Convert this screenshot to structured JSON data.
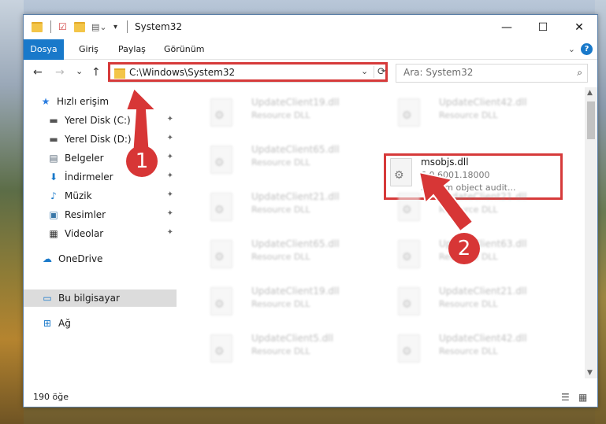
{
  "window": {
    "title": "System32",
    "minimize": "—",
    "maximize": "☐",
    "close": "✕"
  },
  "ribbon": {
    "tabs": [
      "Dosya",
      "Giriş",
      "Paylaş",
      "Görünüm"
    ],
    "help": "?"
  },
  "nav": {
    "back": "←",
    "forward": "→",
    "recent": "⌄",
    "up": "↑"
  },
  "address": {
    "path": "C:\\Windows\\System32",
    "dropdown": "⌄",
    "refresh": "⟳"
  },
  "search": {
    "placeholder": "Ara: System32"
  },
  "sidebar": {
    "items": [
      {
        "label": "Hızlı erişim",
        "icon": "star-icon",
        "glyph": "★",
        "color": "#2b7de0"
      },
      {
        "label": "Yerel Disk (C:)",
        "icon": "drive-icon",
        "glyph": "▬",
        "color": "#444",
        "pinned": true
      },
      {
        "label": "Yerel Disk (D:)",
        "icon": "drive-icon",
        "glyph": "▬",
        "color": "#444",
        "pinned": true
      },
      {
        "label": "Belgeler",
        "icon": "documents-icon",
        "glyph": "▤",
        "color": "#5a6a7a",
        "pinned": true
      },
      {
        "label": "İndirmeler",
        "icon": "download-icon",
        "glyph": "⬇",
        "color": "#1979ca",
        "pinned": true
      },
      {
        "label": "Müzik",
        "icon": "music-icon",
        "glyph": "♪",
        "color": "#1979ca",
        "pinned": true
      },
      {
        "label": "Resimler",
        "icon": "pictures-icon",
        "glyph": "▣",
        "color": "#3a78a8",
        "pinned": true
      },
      {
        "label": "Videolar",
        "icon": "video-icon",
        "glyph": "▦",
        "color": "#333",
        "pinned": true
      },
      {
        "label": "OneDrive",
        "icon": "cloud-icon",
        "glyph": "☁",
        "color": "#1979ca"
      },
      {
        "label": "Bu bilgisayar",
        "icon": "computer-icon",
        "glyph": "▭",
        "color": "#1979ca"
      },
      {
        "label": "Ağ",
        "icon": "network-icon",
        "glyph": "⊞",
        "color": "#1979ca"
      }
    ],
    "pin_glyph": "📌"
  },
  "files": {
    "left": [
      {
        "name": "UpdateClient19.dll",
        "type": "Resource DLL"
      },
      {
        "name": "UpdateClient65.dll",
        "type": "Resource DLL"
      },
      {
        "name": "UpdateClient21.dll",
        "type": "Resource DLL"
      },
      {
        "name": "UpdateClient65.dll",
        "type": "Resource DLL"
      },
      {
        "name": "UpdateClient19.dll",
        "type": "Resource DLL"
      },
      {
        "name": "UpdateClient5.dll",
        "type": "Resource DLL"
      }
    ],
    "right": [
      {
        "name": "UpdateClient42.dll",
        "type": "Resource DLL"
      },
      {
        "name": "UpdateClient21.dll",
        "type": "Resource DLL"
      },
      {
        "name": "UpdateClient63.dll",
        "type": "Resource DLL"
      },
      {
        "name": "UpdateClient21.dll",
        "type": "Resource DLL"
      },
      {
        "name": "UpdateClient42.dll",
        "type": "Resource DLL"
      }
    ],
    "highlighted": {
      "name": "msobjs.dll",
      "version": "6.0.6001.18000",
      "description": "System object audit..."
    }
  },
  "status": {
    "count": "190 öğe"
  },
  "annotations": {
    "badge1": "1",
    "badge2": "2",
    "color": "#d73636"
  }
}
